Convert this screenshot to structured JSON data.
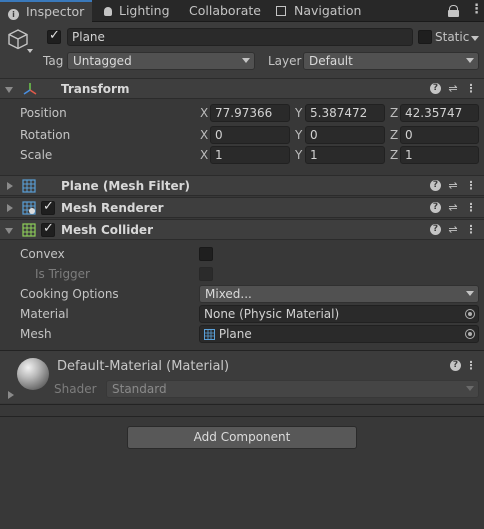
{
  "tabs": {
    "inspector": "Inspector",
    "lighting": "Lighting",
    "collaborate": "Collaborate",
    "navigation": "Navigation"
  },
  "gameobject": {
    "name": "Plane",
    "static_label": "Static",
    "tag_label": "Tag",
    "tag_value": "Untagged",
    "layer_label": "Layer",
    "layer_value": "Default"
  },
  "transform": {
    "title": "Transform",
    "position_label": "Position",
    "rotation_label": "Rotation",
    "scale_label": "Scale",
    "axis_x": "X",
    "axis_y": "Y",
    "axis_z": "Z",
    "position": {
      "x": "77.97366",
      "y": "5.387472",
      "z": "42.35747"
    },
    "rotation": {
      "x": "0",
      "y": "0",
      "z": "0"
    },
    "scale": {
      "x": "1",
      "y": "1",
      "z": "1"
    }
  },
  "components": {
    "mesh_filter": "Plane (Mesh Filter)",
    "mesh_renderer": "Mesh Renderer",
    "mesh_collider": "Mesh Collider"
  },
  "mesh_collider": {
    "convex_label": "Convex",
    "is_trigger_label": "Is Trigger",
    "cooking_label": "Cooking Options",
    "cooking_value": "Mixed...",
    "material_label": "Material",
    "material_value": "None (Physic Material)",
    "mesh_label": "Mesh",
    "mesh_value": "Plane"
  },
  "material": {
    "title": "Default-Material (Material)",
    "shader_label": "Shader",
    "shader_value": "Standard"
  },
  "add_component_label": "Add Component",
  "colors": {
    "background": "#383838",
    "tab_bar": "#282828",
    "accent": "#3a79bb",
    "field": "#2a2a2a"
  }
}
